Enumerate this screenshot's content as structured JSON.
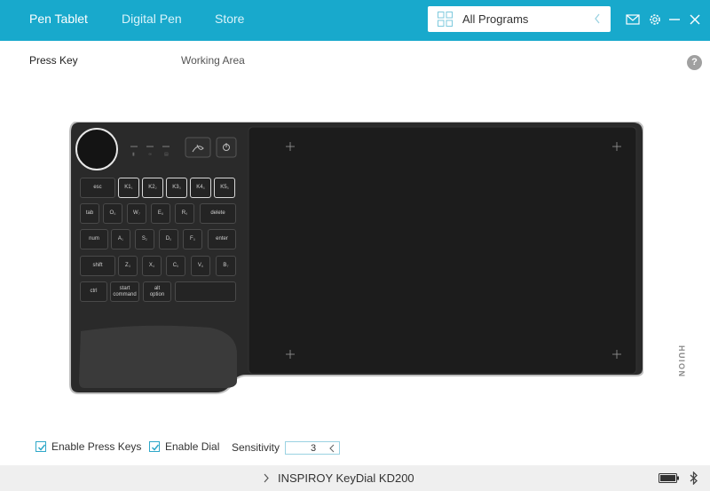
{
  "header": {
    "tabs": [
      {
        "label": "Pen Tablet",
        "active": true
      },
      {
        "label": "Digital Pen",
        "active": false
      },
      {
        "label": "Store",
        "active": false
      }
    ],
    "program_select": {
      "selected": "All Programs"
    },
    "icons": [
      "grid-icon",
      "mail-icon",
      "gear-icon",
      "minimize-icon",
      "close-icon"
    ]
  },
  "subtabs": [
    {
      "label": "Press Key",
      "active": true
    },
    {
      "label": "Working Area",
      "active": false
    }
  ],
  "help": {
    "label": "?"
  },
  "tablet": {
    "brand": "HUION",
    "keys": {
      "esc": "esc",
      "k1": "K1",
      "k1_sub": "1",
      "k2": "K2",
      "k2_sub": "2",
      "k3": "K3",
      "k3_sub": "3",
      "k4": "K4",
      "k4_sub": "4",
      "k5": "K5",
      "k5_sub": "5",
      "tab": "tab",
      "o": "O",
      "o_sub": "6",
      "w": "W",
      "w_sub": "7",
      "e": "E",
      "e_sub": "8",
      "r": "R",
      "r_sub": "9",
      "delete": "delete",
      "num": "num",
      "a": "A",
      "a_sub": "1",
      "s": "S",
      "s_sub": "2",
      "d": "D",
      "d_sub": "0",
      "f": "F",
      "f_sub": "0",
      "enter": "enter",
      "shift": "shift",
      "z": "Z",
      "z_sub": "3",
      "x": "X",
      "x_sub": "4",
      "c": "C",
      "c_sub": "5",
      "v": "V",
      "v_sub": "6",
      "b": "B",
      "b_sub": "7",
      "ctrl": "ctrl",
      "start": "start",
      "command": "command",
      "alt": "alt",
      "option": "option"
    }
  },
  "options": {
    "enable_press_keys": {
      "label": "Enable Press Keys",
      "checked": true
    },
    "enable_dial": {
      "label": "Enable Dial",
      "checked": true
    },
    "sensitivity": {
      "label": "Sensitivity",
      "value": "3"
    }
  },
  "status": {
    "device": "INSPIROY KeyDial KD200",
    "battery": "full"
  },
  "colors": {
    "accent": "#18a9cc",
    "statusbar": "#efefef"
  }
}
